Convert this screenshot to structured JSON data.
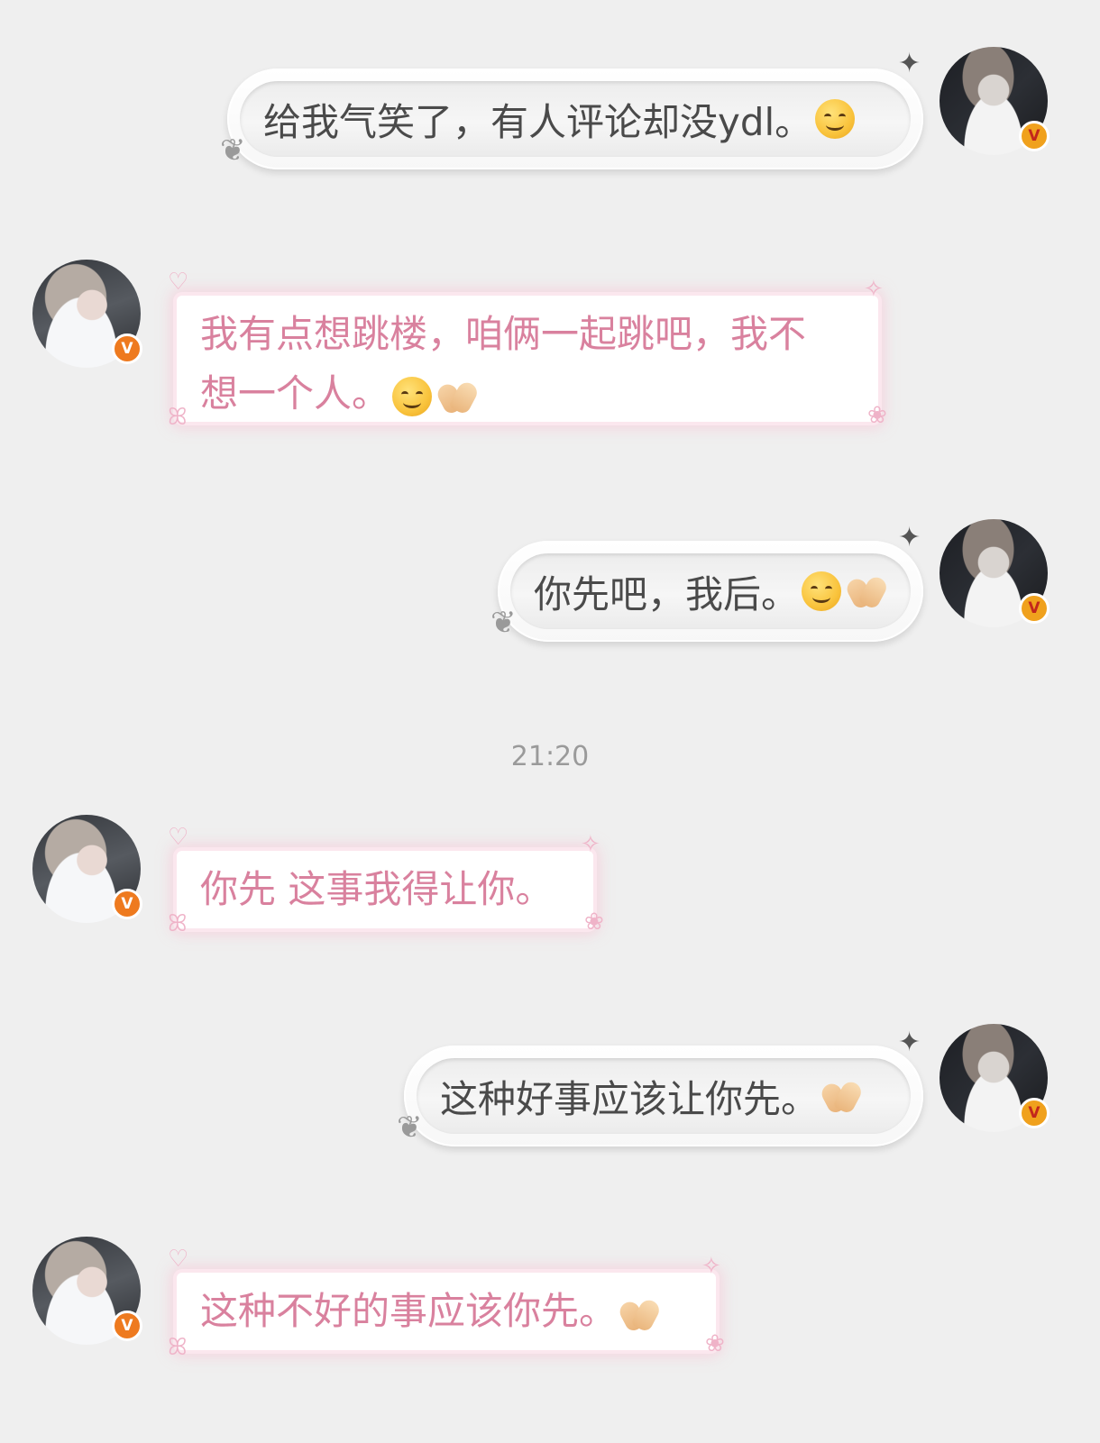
{
  "timestamp": "21:20",
  "colors": {
    "background": "#efefef",
    "my_text": "#4a4a4a",
    "her_text": "#d9819e",
    "her_glow": "#f7c4d6",
    "badge_gold": "#f0a11d",
    "badge_orange": "#ee7a1f"
  },
  "messages": [
    {
      "sender": "me",
      "text": "给我气笑了，有人评论却没ydl。",
      "emoji": [
        "smiling-face"
      ]
    },
    {
      "sender": "her",
      "line1": "我有点想跳楼，咱俩一起跳吧，我不",
      "line2": "想一个人。",
      "emoji": [
        "smiling-face",
        "pinched-hands"
      ]
    },
    {
      "sender": "me",
      "text": "你先吧，我后。",
      "emoji": [
        "smiling-face",
        "pinched-hands"
      ]
    },
    {
      "sender": "her",
      "text": "你先 这事我得让你。",
      "emoji": []
    },
    {
      "sender": "me",
      "text": "这种好事应该让你先。",
      "emoji": [
        "pinched-hands"
      ]
    },
    {
      "sender": "her",
      "text": "这种不好的事应该你先。",
      "emoji": [
        "pinched-hands"
      ]
    }
  ],
  "badges": {
    "verified": "V"
  }
}
